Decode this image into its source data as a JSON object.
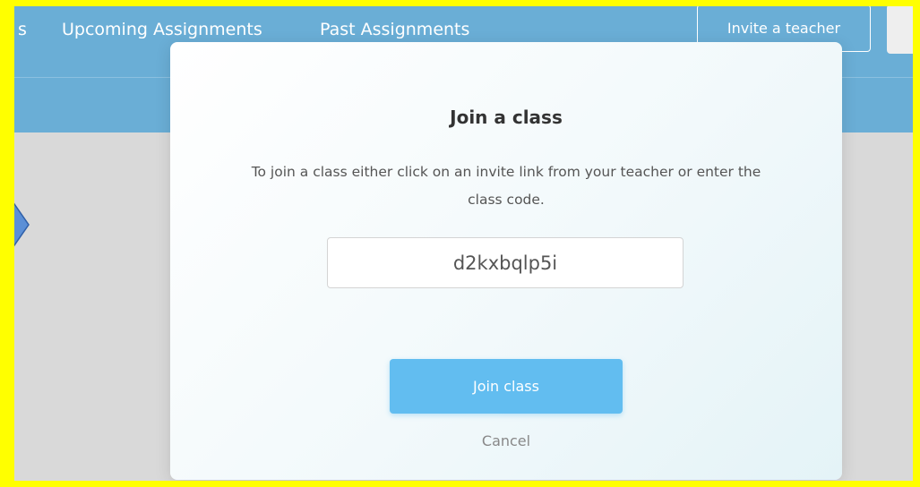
{
  "nav": {
    "partial_label": "s",
    "upcoming_label": "Upcoming Assignments",
    "past_label": "Past Assignments",
    "invite_label": "Invite a teacher"
  },
  "modal": {
    "title": "Join a class",
    "description": "To join a class either click on an invite link from your teacher or enter the class code.",
    "code_value": "d2kxbqlp5i",
    "join_label": "Join class",
    "cancel_label": "Cancel"
  },
  "colors": {
    "highlight_border": "#ffff00",
    "header_bg": "#6aaed6",
    "join_button": "#62bdf0"
  }
}
